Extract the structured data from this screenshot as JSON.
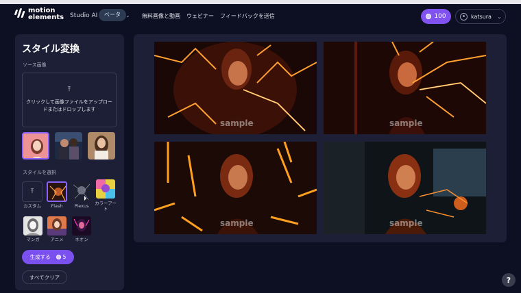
{
  "header": {
    "logo_line1": "motion",
    "logo_line2": "elements",
    "app_name": "Studio AI",
    "beta_badge": "ベータ",
    "nav": [
      "無料画像と動画",
      "ウェビナー",
      "フィードバックを送信"
    ],
    "credits": "100",
    "username": "katsura"
  },
  "sidebar": {
    "title": "スタイル変換",
    "source_label": "ソース画像",
    "upload_icon": "upload-icon",
    "upload_text": "クリックして画像ファイルをアップロードまたはドロップします",
    "source_thumbs": [
      "portrait-woman-pink",
      "couple-night",
      "woman-brown-hair"
    ],
    "style_label": "スタイルを選択",
    "styles": [
      {
        "label": "カスタム",
        "selected": false
      },
      {
        "label": "Flash",
        "selected": true
      },
      {
        "label": "Plexus",
        "selected": false
      },
      {
        "label": "カラーアート",
        "selected": false
      },
      {
        "label": "マンガ",
        "selected": false
      },
      {
        "label": "アニメ",
        "selected": false
      },
      {
        "label": "ネオン",
        "selected": false
      }
    ],
    "generate_label": "生成する",
    "generate_cost": "5",
    "clear_label": "すべてクリア"
  },
  "results": {
    "watermark": "sample"
  },
  "help": "?",
  "colors": {
    "accent": "#7a50ee",
    "panel": "#1c1f35",
    "background": "#0d0f22"
  }
}
